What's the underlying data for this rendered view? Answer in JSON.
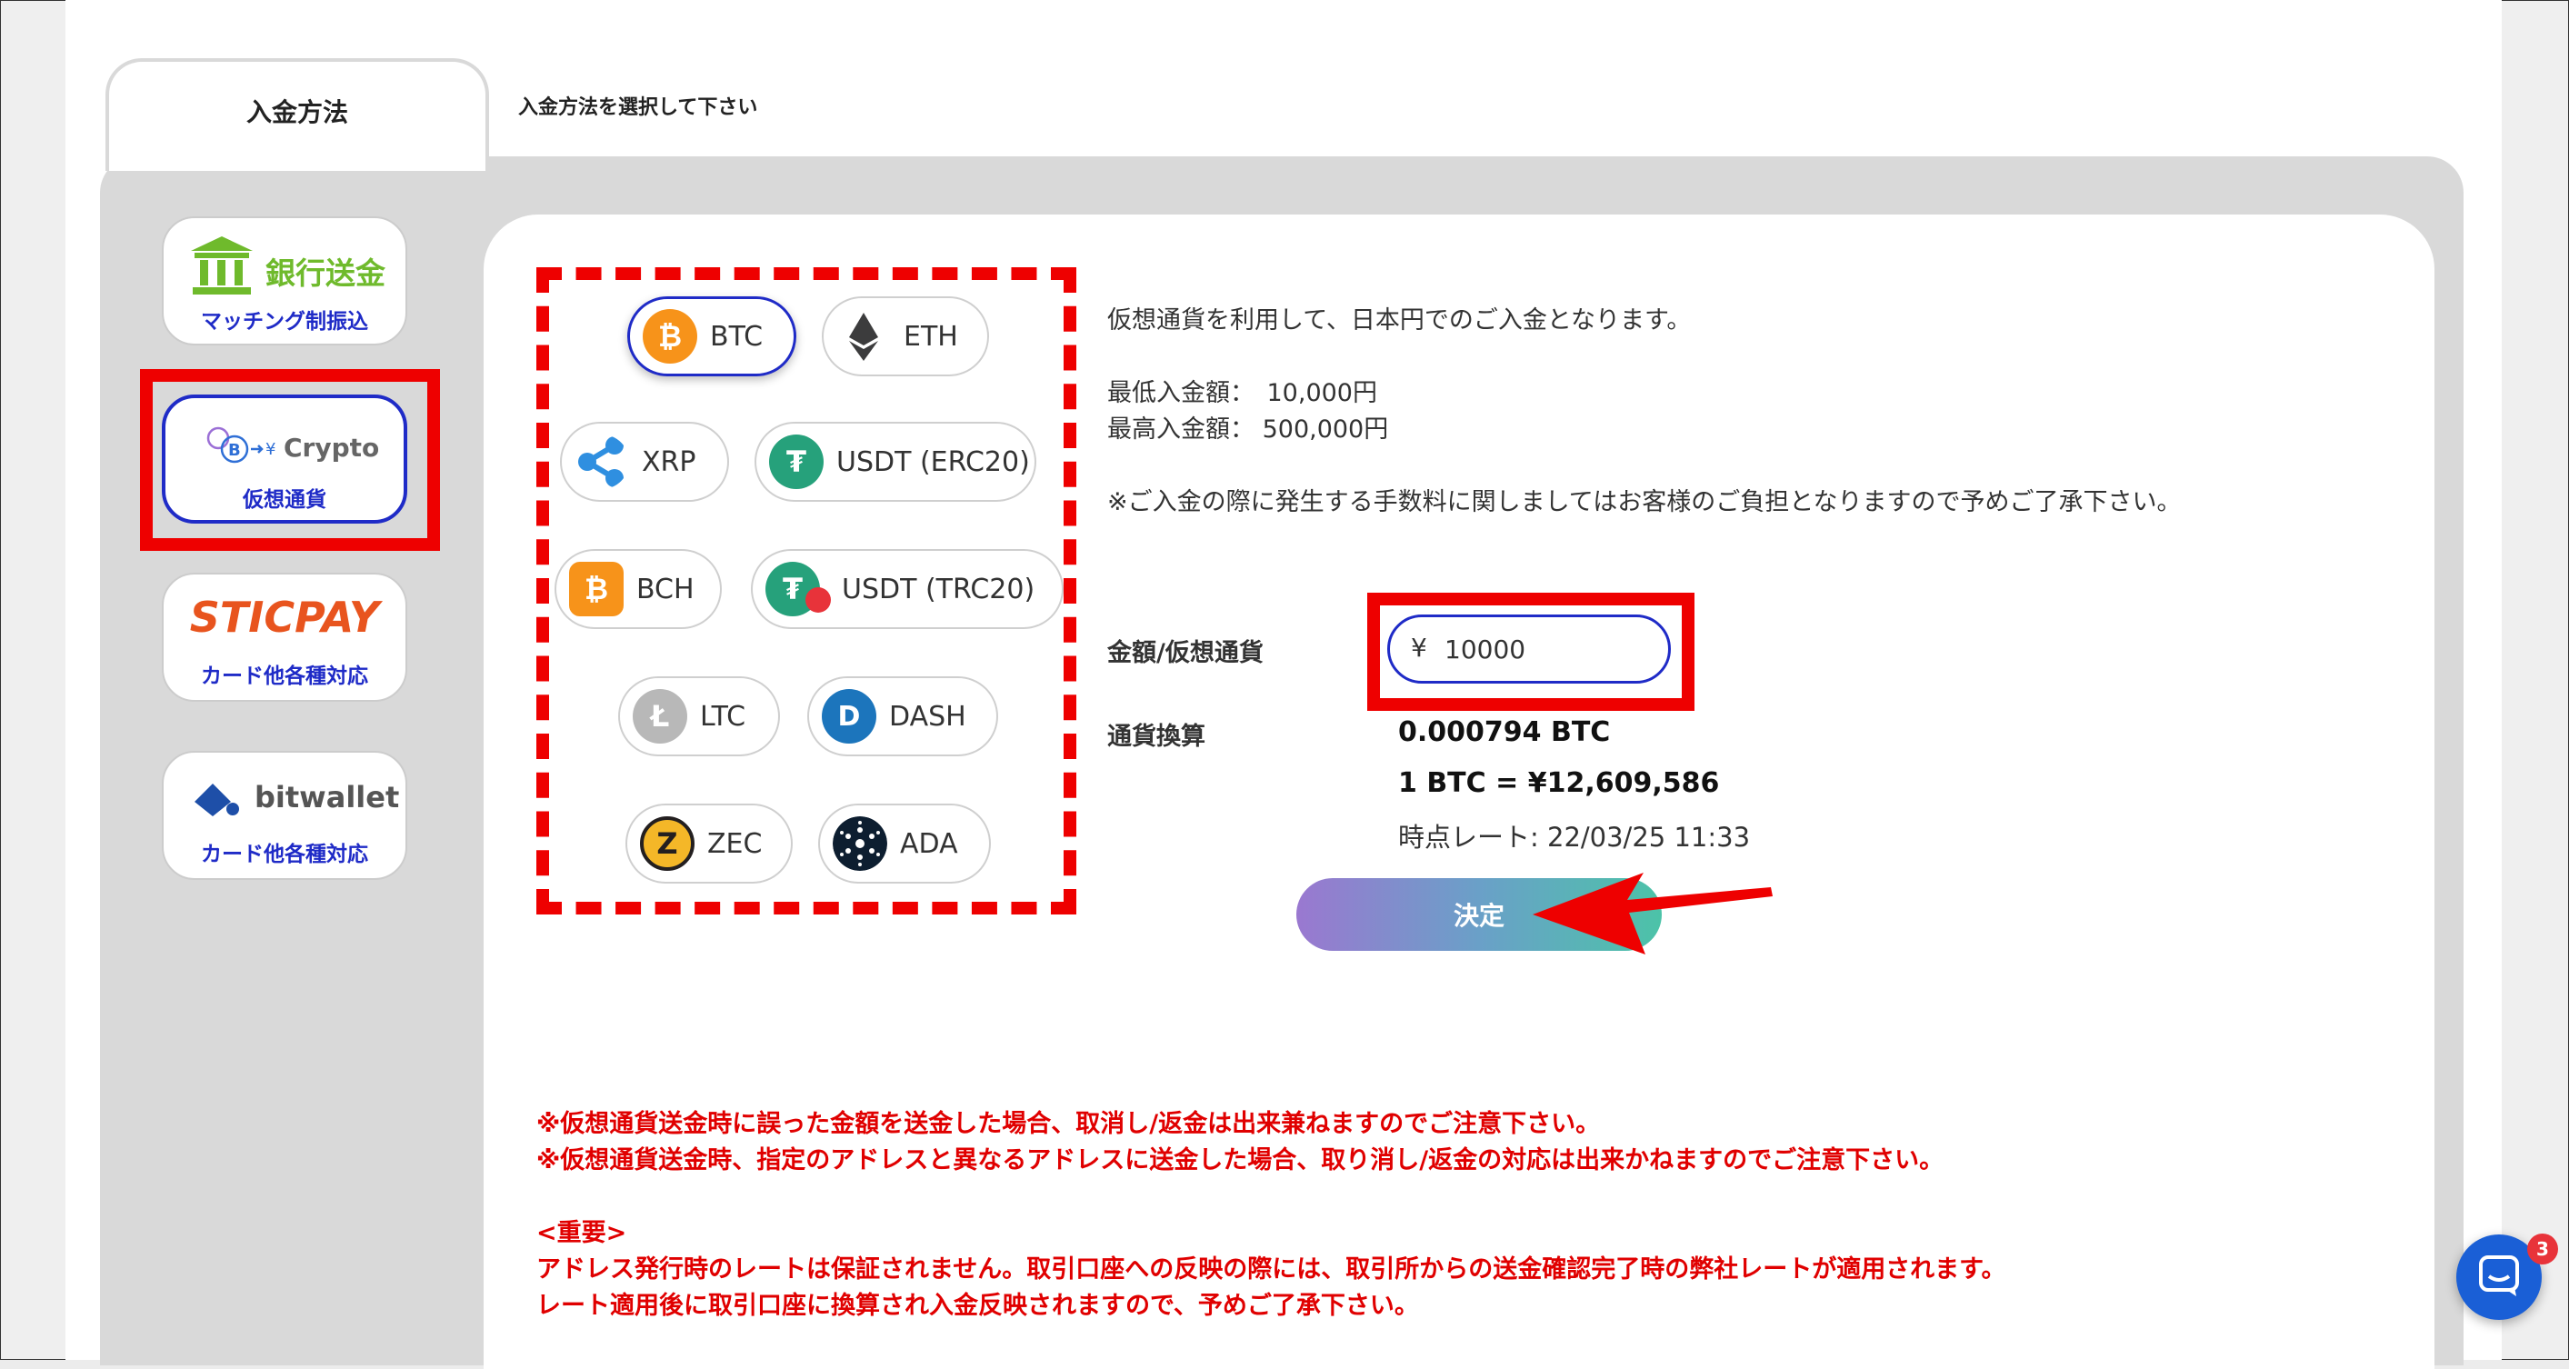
{
  "tab": {
    "title": "入金方法",
    "hint": "入金方法を選択して下さい"
  },
  "sidebar": {
    "items": [
      {
        "logo": "銀行送金",
        "label": "マッチング制振込"
      },
      {
        "logo": "Crypto",
        "label": "仮想通貨"
      },
      {
        "logo": "STICPAY",
        "label": "カード他各種対応"
      },
      {
        "logo": "bitwallet",
        "label": "カード他各種対応"
      }
    ]
  },
  "coins": [
    {
      "label": "BTC",
      "icon": "bitcoin-icon",
      "color": "#f7931a",
      "selected": true
    },
    {
      "label": "ETH",
      "icon": "ethereum-icon",
      "color": "#3c3c3d"
    },
    {
      "label": "XRP",
      "icon": "xrp-icon",
      "color": "#2f8fe0"
    },
    {
      "label": "USDT (ERC20)",
      "icon": "tether-icon",
      "color": "#26a17b"
    },
    {
      "label": "BCH",
      "icon": "bitcoin-cash-icon",
      "color": "#f7931a"
    },
    {
      "label": "USDT (TRC20)",
      "icon": "tether-tron-icon",
      "color": "#26a17b"
    },
    {
      "label": "LTC",
      "icon": "litecoin-icon",
      "color": "#b8b8b8"
    },
    {
      "label": "DASH",
      "icon": "dash-icon",
      "color": "#1c75bc"
    },
    {
      "label": "ZEC",
      "icon": "zcash-icon",
      "color": "#f4b728"
    },
    {
      "label": "ADA",
      "icon": "cardano-icon",
      "color": "#0d1e30"
    }
  ],
  "info": {
    "intro": "仮想通貨を利用して、日本円でのご入金となります。",
    "min": "最低入金額：　10,000円",
    "max": "最高入金額：  500,000円",
    "fee_note": "※ご入金の際に発生する手数料に関しましてはお客様のご負担となりますので予めご了承下さい。"
  },
  "form": {
    "amount_label": "金額/仮想通貨",
    "currency_symbol": "¥",
    "amount_value": "10000",
    "conversion_label": "通貨換算",
    "converted": "0.000794 BTC",
    "rate": "1 BTC = ¥12,609,586",
    "rate_time": "時点レート: 22/03/25 11:33",
    "submit": "決定"
  },
  "warnings": {
    "w1": "※仮想通貨送金時に誤った金額を送金した場合、取消し/返金は出来兼ねますのでご注意下さい。",
    "w2": "※仮想通貨送金時、指定のアドレスと異なるアドレスに送金した場合、取り消し/返金の対応は出来かねますのでご注意下さい。",
    "important": "<重要>",
    "w3": "アドレス発行時のレートは保証されません。取引口座への反映の際には、取引所からの送金確認完了時の弊社レートが適用されます。",
    "w4": "レート適用後に取引口座に換算され入金反映されますので、予めご了承下さい。"
  },
  "chat": {
    "badge": "3"
  }
}
